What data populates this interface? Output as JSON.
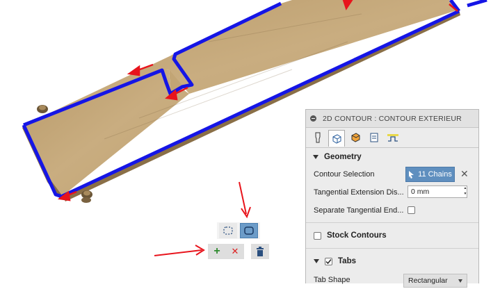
{
  "panel": {
    "title": "2D CONTOUR : CONTOUR EXTERIEUR",
    "tabs": [
      "tool-icon",
      "geometry-icon",
      "heights-icon",
      "passes-icon",
      "linking-icon"
    ],
    "geometry": {
      "header": "Geometry",
      "contour_selection_label": "Contour Selection",
      "contour_selection_value": "11 Chains",
      "tangential_extension_label": "Tangential Extension Dis...",
      "tangential_extension_value": "0 mm",
      "separate_tangential_label": "Separate Tangential End...",
      "separate_tangential_checked": false
    },
    "stock_contours_label": "Stock Contours",
    "stock_contours_checked": false,
    "tabs_section_label": "Tabs",
    "tabs_section_checked": true,
    "tab_shape_label": "Tab Shape",
    "tab_shape_value": "Rectangular"
  },
  "mini_toolbar": {
    "open_chain_icon": "dashed-rect-icon",
    "closed_chain_icon": "rounded-rect-icon",
    "add_icon": "+",
    "remove_icon": "✕",
    "delete_icon": "trash-icon"
  },
  "colors": {
    "toolpath": "#1515e6",
    "arrow": "#e8141c",
    "wood": "#c6a77a",
    "active_button": "#5f8fbf"
  }
}
